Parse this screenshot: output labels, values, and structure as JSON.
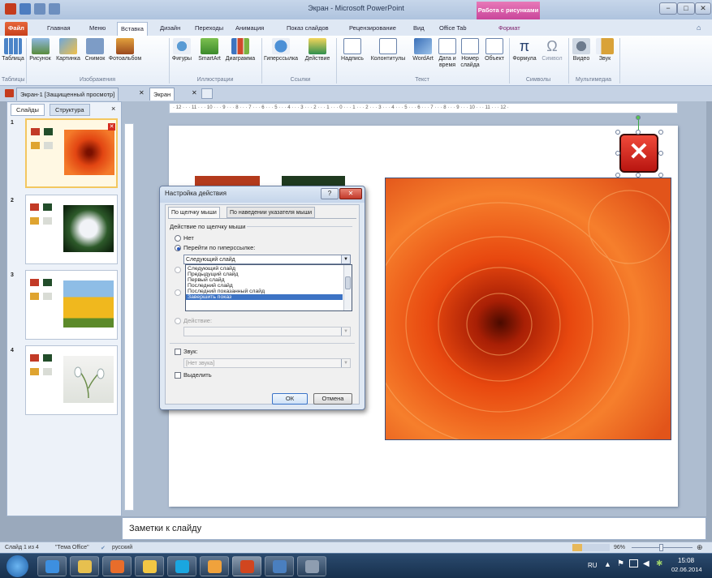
{
  "titlebar": {
    "title": "Экран - Microsoft PowerPoint",
    "context_tab_header": "Работа с рисунками",
    "min": "−",
    "max": "□",
    "close": "✕"
  },
  "tabs": [
    {
      "label": "Файл"
    },
    {
      "label": "Главная"
    },
    {
      "label": "Меню"
    },
    {
      "label": "Вставка"
    },
    {
      "label": "Дизайн"
    },
    {
      "label": "Переходы"
    },
    {
      "label": "Анимация"
    },
    {
      "label": "Показ слайдов"
    },
    {
      "label": "Рецензирование"
    },
    {
      "label": "Вид"
    },
    {
      "label": "Office Tab"
    },
    {
      "label": "Формат"
    }
  ],
  "ribbon": {
    "buttons": [
      {
        "label": "Таблица",
        "icon": "table-icon"
      },
      {
        "label": "Рисунок",
        "icon": "picture-icon"
      },
      {
        "label": "Картинка",
        "icon": "clipart-icon"
      },
      {
        "label": "Снимок",
        "icon": "screenshot-icon"
      },
      {
        "label": "Фотоальбом",
        "icon": "photo-album-icon"
      },
      {
        "label": "Фигуры",
        "icon": "shapes-icon"
      },
      {
        "label": "SmartArt",
        "icon": "smartart-icon"
      },
      {
        "label": "Диаграмма",
        "icon": "chart-icon"
      },
      {
        "label": "Гиперссылка",
        "icon": "hyperlink-icon"
      },
      {
        "label": "Действие",
        "icon": "action-icon"
      },
      {
        "label": "Надпись",
        "icon": "textbox-icon"
      },
      {
        "label": "Колонтитулы",
        "icon": "header-footer-icon"
      },
      {
        "label": "WordArt",
        "icon": "wordart-icon"
      },
      {
        "label": "Дата и время",
        "icon": "date-time-icon"
      },
      {
        "label": "Номер слайда",
        "icon": "slide-number-icon"
      },
      {
        "label": "Объект",
        "icon": "object-icon"
      },
      {
        "label": "Формула",
        "icon": "formula-icon"
      },
      {
        "label": "Символ",
        "icon": "symbol-icon"
      },
      {
        "label": "Видео",
        "icon": "video-icon"
      },
      {
        "label": "Звук",
        "icon": "audio-icon"
      }
    ],
    "groups": [
      "Таблицы",
      "Изображения",
      "Иллюстрации",
      "Ссылки",
      "Текст",
      "Символы",
      "Мультимедиа"
    ]
  },
  "doc_tabs": {
    "tab1": "Экран-1 [Защищенный просмотр]",
    "tab2": "Экран"
  },
  "left_pane": {
    "tab_slides": "Слайды",
    "tab_outline": "Структура",
    "close": "×",
    "slide_numbers": [
      "1",
      "2",
      "3",
      "4"
    ]
  },
  "ruler": {
    "h": "· 12 · · · 11 · · · 10 · · · 9 · · · 8 · · · 7 · · · 6 · · · 5 · · · 4 · · · 3 · · · 2 · · · 1 · · · 0 · · · 1 · · · 2 · · · 3 · · · 4 · · · 5 · · · 6 · · · 7 · · · 8 · · · 9 · · · 10 · · · 11 · · · 12 ·"
  },
  "slide": {
    "close_glyph": "✕"
  },
  "dialog": {
    "title": "Настройка действия",
    "help": "?",
    "close": "✕",
    "tab1": "По щелчку мыши",
    "tab2": "По наведении указателя мыши",
    "group_label": "Действие по щелчку мыши",
    "opt_none": "Нет",
    "opt_hyperlink": "Перейти по гиперссылке:",
    "hyperlink_value": "Следующий слайд",
    "dropdown_options": [
      "Следующий слайд",
      "Предыдущий слайд",
      "Первый слайд",
      "Последний слайд",
      "Последний показанный слайд",
      "Завершить показ"
    ],
    "highlighted_index": 5,
    "opt_action": "Действие:",
    "sound_label": "Звук:",
    "sound_value": "[Нет звука]",
    "highlight_label": "Выделить",
    "ok": "ОК",
    "cancel": "Отмена"
  },
  "notes": {
    "placeholder": "Заметки к слайду"
  },
  "status": {
    "slide": "Слайд 1 из 4",
    "theme": "\"Тема Office\"",
    "lang": "русский",
    "zoom": "96%"
  },
  "taskbar": {
    "lang": "RU",
    "time": "15:08",
    "date": "02.06.2014"
  }
}
